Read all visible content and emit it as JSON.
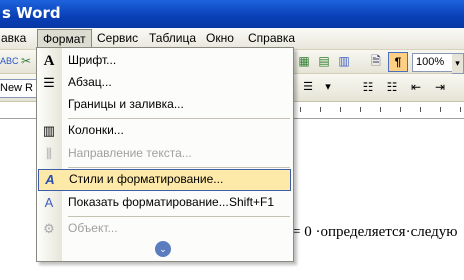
{
  "window": {
    "title": "s Word"
  },
  "menubar": [
    {
      "label": "авка"
    },
    {
      "label": "Формат"
    },
    {
      "label": "Сервис"
    },
    {
      "label": "Таблица"
    },
    {
      "label": "Окно"
    },
    {
      "label": "Справка"
    }
  ],
  "toolbar": {
    "zoom": "100%",
    "font_name": "New R"
  },
  "format_menu": {
    "items": [
      {
        "label": "Шрифт...",
        "icon": "font-icon",
        "disabled": false
      },
      {
        "label": "Абзац...",
        "icon": "paragraph-icon",
        "disabled": false
      },
      {
        "label": "Границы и заливка...",
        "icon": "",
        "disabled": false
      },
      {
        "label": "Колонки...",
        "icon": "columns-icon",
        "disabled": false
      },
      {
        "label": "Направление текста...",
        "icon": "text-direction-icon",
        "disabled": true
      },
      {
        "label": "Стили и форматирование...",
        "icon": "styles-icon",
        "disabled": false,
        "highlighted": true
      },
      {
        "label": "Показать форматирование...",
        "shortcut": "Shift+F1",
        "icon": "reveal-formatting-icon",
        "disabled": false
      },
      {
        "label": "Объект...",
        "icon": "object-icon",
        "disabled": true
      }
    ]
  },
  "document": {
    "visible_text": "= 0 ·определяется·следую"
  }
}
